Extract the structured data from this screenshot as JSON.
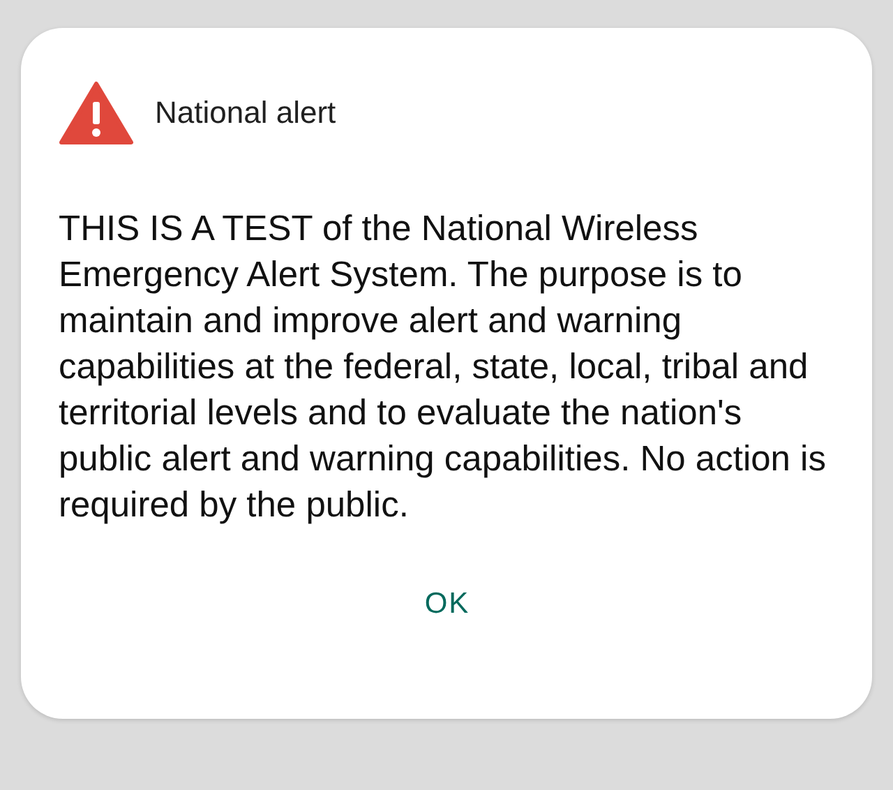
{
  "dialog": {
    "title": "National alert",
    "message": "THIS IS A TEST of the National Wireless Emergency Alert System. The purpose is to maintain and improve alert and warning capabilities at the federal, state, local, tribal and territorial levels and to evaluate the nation's public alert and warning capabilities. No action is required by the public.",
    "buttons": [
      "OK"
    ]
  }
}
